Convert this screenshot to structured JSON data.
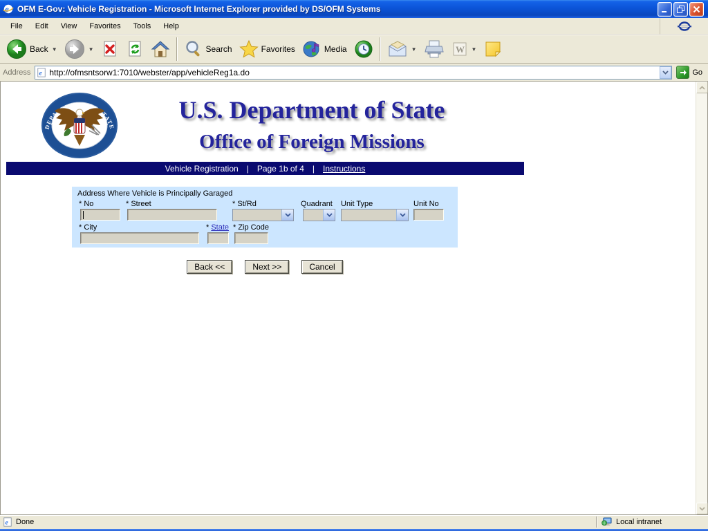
{
  "window": {
    "title": "OFM E-Gov: Vehicle Registration - Microsoft Internet Explorer provided by DS/OFM Systems"
  },
  "menu": {
    "items": [
      "File",
      "Edit",
      "View",
      "Favorites",
      "Tools",
      "Help"
    ]
  },
  "toolbar": {
    "back_label": "Back",
    "search_label": "Search",
    "favorites_label": "Favorites",
    "media_label": "Media"
  },
  "address": {
    "label": "Address",
    "url": "http://ofmsntsorw1:7010/webster/app/vehicleReg1a.do",
    "go_label": "Go"
  },
  "page": {
    "header": {
      "line1": "U.S. Department of State",
      "line2": "Office of Foreign Missions"
    },
    "navbar": {
      "section": "Vehicle Registration",
      "separator": "|",
      "page": "Page 1b of 4",
      "instructions": "Instructions"
    },
    "form": {
      "legend": "Address Where Vehicle is Principally Garaged",
      "labels": {
        "no": "* No",
        "street": "* Street",
        "st_rd": "* St/Rd",
        "quadrant": "Quadrant",
        "unit_type": "Unit Type",
        "unit_no": "Unit No",
        "city": "* City",
        "state_star": "*",
        "state": "State",
        "zip": "* Zip Code"
      }
    },
    "buttons": {
      "back": "Back <<",
      "next": "Next >>",
      "cancel": "Cancel"
    }
  },
  "statusbar": {
    "status": "Done",
    "zone": "Local intranet"
  },
  "colors": {
    "titlebar_blue": "#0b54d8",
    "navbar_navy": "#0a0a70",
    "form_bg": "#cce6ff",
    "header_text": "#24249c",
    "chrome_bg": "#ece9d8"
  }
}
